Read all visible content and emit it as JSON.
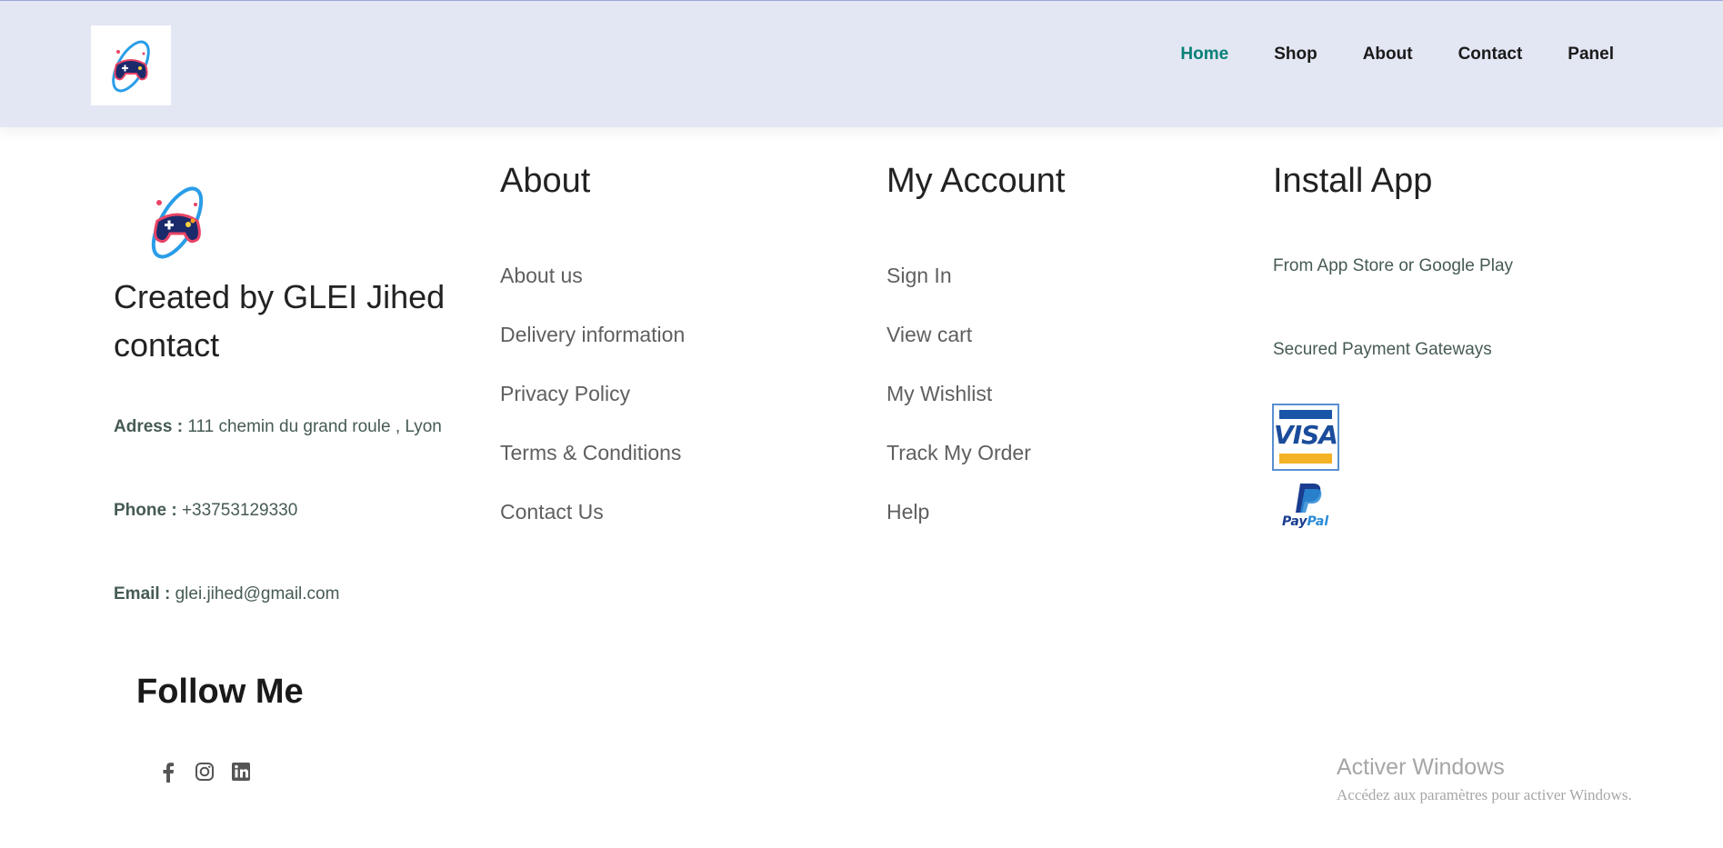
{
  "header": {
    "nav": [
      "Home",
      "Shop",
      "About",
      "Contact",
      "Panel"
    ],
    "active": "Home"
  },
  "brand": {
    "created_line1": "Created by GLEI Jihed",
    "created_line2": "contact",
    "address_label": "Adress :",
    "address_value": "111 chemin du grand roule , Lyon",
    "phone_label": "Phone :",
    "phone_value": "+33753129330",
    "email_label": "Email :",
    "email_value": "glei.jihed@gmail.com"
  },
  "about": {
    "title": "About",
    "links": [
      "About us",
      "Delivery information",
      "Privacy Policy",
      "Terms & Conditions",
      "Contact Us"
    ]
  },
  "account": {
    "title": "My Account",
    "links": [
      "Sign In",
      "View cart",
      "My Wishlist",
      "Track My Order",
      "Help"
    ]
  },
  "install": {
    "title": "Install App",
    "stores": "From App Store or Google Play",
    "payments": "Secured Payment Gateways",
    "visa": "VISA",
    "paypal_a": "Pay",
    "paypal_b": "Pal"
  },
  "follow": {
    "title": "Follow Me",
    "icons": [
      "facebook-icon",
      "instagram-icon",
      "linkedin-icon"
    ]
  },
  "watermark": {
    "line1": "Activer Windows",
    "line2": "Accédez aux paramètres pour activer Windows."
  },
  "colors": {
    "header_bg": "#e3e6f3",
    "accent": "#088178",
    "text_dark": "#222222",
    "text_muted": "#465b52"
  }
}
